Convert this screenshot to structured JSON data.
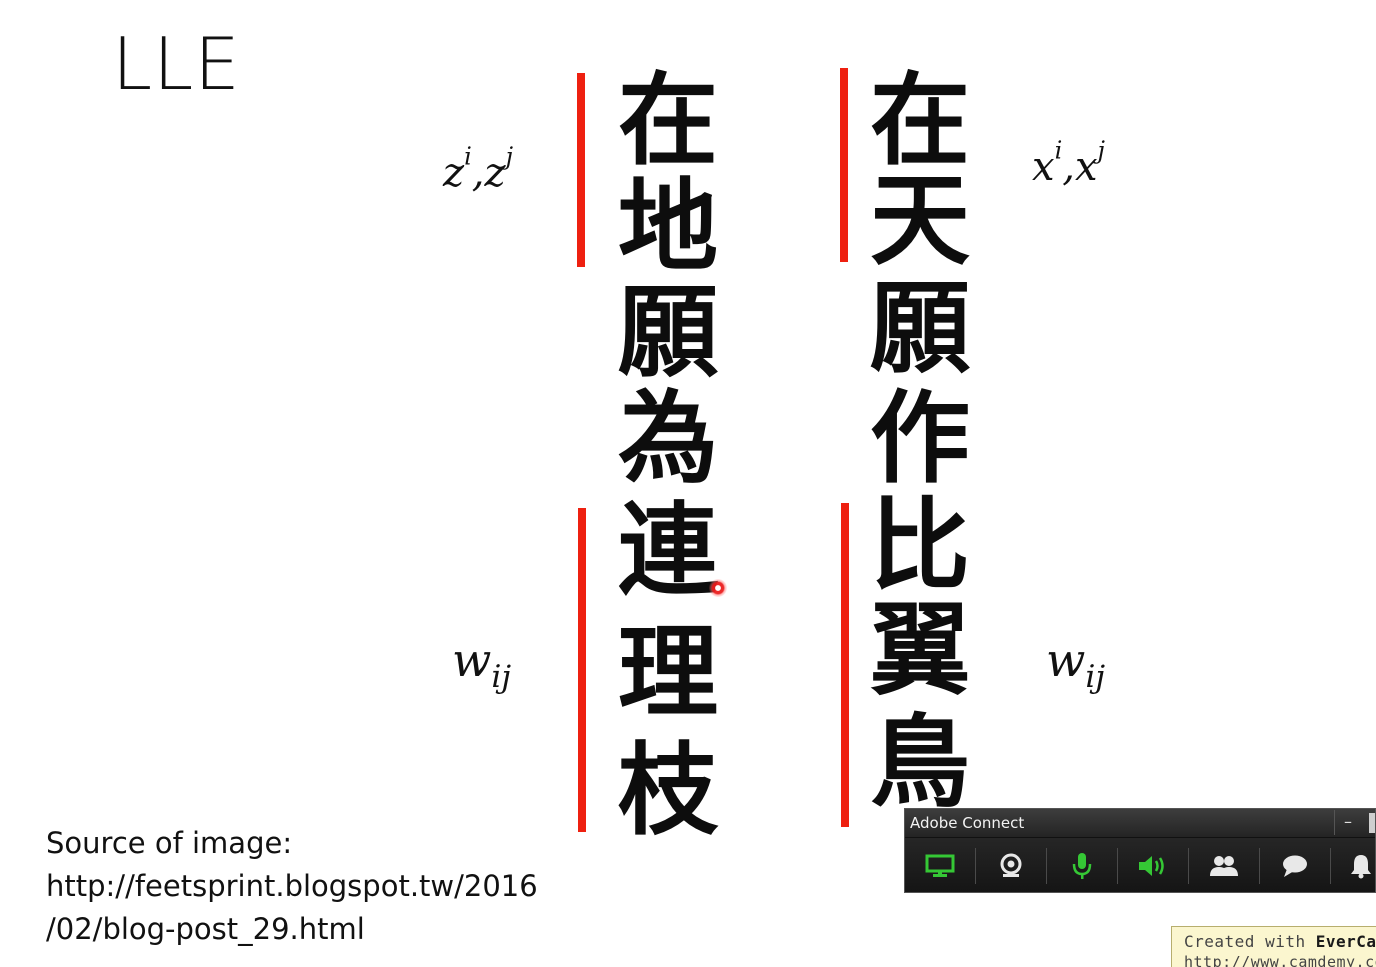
{
  "slide": {
    "title": "LLE",
    "math": {
      "low_dim_label": {
        "base1": "z",
        "sup1": "i",
        "sep": ",",
        "base2": "z",
        "sup2": "j"
      },
      "high_dim_label": {
        "base1": "x",
        "sup1": "i",
        "sep": ",",
        "base2": "x",
        "sup2": "j"
      },
      "weight_left": {
        "base": "w",
        "sub": "ij"
      },
      "weight_right": {
        "base": "w",
        "sub": "ij"
      }
    },
    "poem": {
      "left_column": [
        "在",
        "地",
        "願",
        "為",
        "連",
        "理",
        "枝"
      ],
      "right_column": [
        "在",
        "天",
        "願",
        "作",
        "比",
        "翼",
        "鳥"
      ]
    },
    "colors": {
      "bracket_red": "#ee2010",
      "text": "#111111"
    },
    "source": {
      "line1": "Source of image:",
      "line2": "http://feetsprint.blogspot.tw/2016",
      "line3": "/02/blog-post_29.html"
    }
  },
  "adobe_connect": {
    "title": "Adobe Connect",
    "minimize_label": "–",
    "buttons": [
      {
        "name": "share-screen",
        "icon": "monitor-icon",
        "color": "#35c835"
      },
      {
        "name": "camera",
        "icon": "webcam-icon",
        "color": "#e8e8e8"
      },
      {
        "name": "microphone",
        "icon": "microphone-icon",
        "color": "#35c835"
      },
      {
        "name": "speaker",
        "icon": "speaker-icon",
        "color": "#35c835"
      },
      {
        "name": "attendees",
        "icon": "people-icon",
        "color": "#e8e8e8"
      },
      {
        "name": "chat",
        "icon": "chat-bubble-icon",
        "color": "#e8e8e8"
      },
      {
        "name": "notifications",
        "icon": "bell-icon",
        "color": "#e8e8e8"
      }
    ]
  },
  "watermark": {
    "prefix": "Created with ",
    "brand": "EverCam",
    "url": "http://www.camdemy.com"
  }
}
